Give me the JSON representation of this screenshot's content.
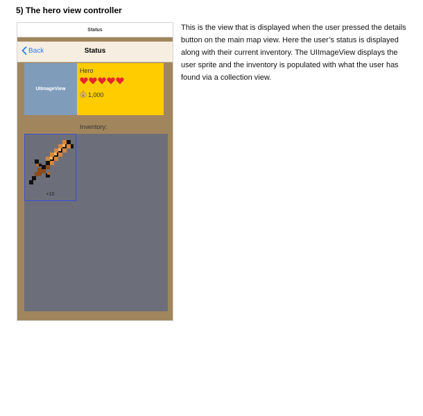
{
  "heading": "5) The hero view controller",
  "phone": {
    "scene_title": "Status",
    "nav": {
      "back_label": "Back",
      "title": "Status"
    },
    "image_view_label": "UIImageView",
    "hero": {
      "name": "Hero",
      "hearts": 5,
      "coins": "1,000"
    },
    "inventory_label": "Inventory:",
    "inventory_items": [
      {
        "icon": "sword-icon",
        "count": "+10"
      }
    ],
    "colors": {
      "accent": "#2a7cf6",
      "hero_panel": "#ffcc00",
      "background": "#a1865d"
    }
  },
  "description": "This is the view that is displayed when the user pressed the details button on the main map view. Here the user’s status is displayed along with their current inventory. The UIImageView displays the user sprite and the inventory is populated with what the user has found via a collection view."
}
